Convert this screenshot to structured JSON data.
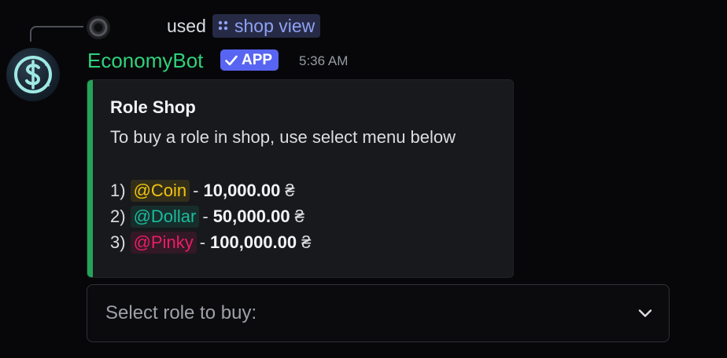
{
  "reply": {
    "used_label": "used",
    "command_label": "shop view"
  },
  "message": {
    "author": "EconomyBot",
    "badge": "APP",
    "timestamp": "5:36 AM",
    "avatar_icon": "dollar-coin-icon"
  },
  "embed": {
    "accent_color": "#23a559",
    "title": "Role Shop",
    "description": "To buy a role in shop, use select menu below",
    "items": [
      {
        "index": "1)",
        "mention": "@Coin",
        "separator": "-",
        "price": "10,000.00",
        "currency": "₴",
        "color": "#f1c40f"
      },
      {
        "index": "2)",
        "mention": "@Dollar",
        "separator": "-",
        "price": "50,000.00",
        "currency": "₴",
        "color": "#1abc9c"
      },
      {
        "index": "3)",
        "mention": "@Pinky",
        "separator": "-",
        "price": "100,000.00",
        "currency": "₴",
        "color": "#e91e63"
      }
    ]
  },
  "select_menu": {
    "placeholder": "Select role to buy:",
    "icon": "chevron-down-icon"
  },
  "colors": {
    "bot_name": "#2fd27c",
    "app_badge": "#5865f2",
    "command_link": "#8ea1f5"
  }
}
